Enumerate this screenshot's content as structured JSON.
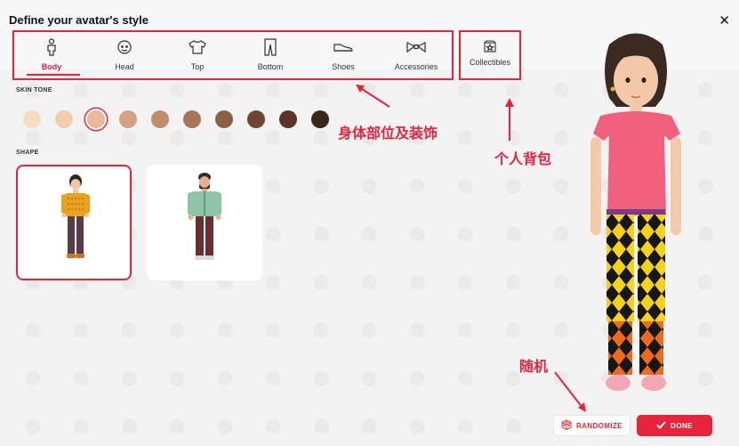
{
  "title": "Define your avatar's style",
  "close_icon": "close-icon",
  "tabs": [
    {
      "label": "Body",
      "icon": "body-icon",
      "active": true
    },
    {
      "label": "Head",
      "icon": "head-icon",
      "active": false
    },
    {
      "label": "Top",
      "icon": "shirt-icon",
      "active": false
    },
    {
      "label": "Bottom",
      "icon": "pants-icon",
      "active": false
    },
    {
      "label": "Shoes",
      "icon": "shoe-icon",
      "active": false
    },
    {
      "label": "Accessories",
      "icon": "bowtie-icon",
      "active": false
    }
  ],
  "collectibles": {
    "label": "Collectibles",
    "icon": "collectible-box-icon"
  },
  "skin_tone": {
    "label": "SKIN TONE",
    "colors": [
      "#f7dcbf",
      "#f4ceaa",
      "#e9b99a",
      "#d4a27e",
      "#c38d68",
      "#a87456",
      "#8d5e46",
      "#704633",
      "#5a3424",
      "#3c2417"
    ],
    "selected_index": 2
  },
  "shape": {
    "label": "SHAPE",
    "options": [
      {
        "name": "female-shape",
        "selected": true
      },
      {
        "name": "male-shape",
        "selected": false
      }
    ]
  },
  "annotations": {
    "body_parts": "身体部位及装饰",
    "backpack": "个人背包",
    "random": "随机"
  },
  "buttons": {
    "randomize": "RANDOMIZE",
    "done": "DONE"
  },
  "colors": {
    "accent": "#e8243d",
    "background": "#f3f3f3"
  }
}
